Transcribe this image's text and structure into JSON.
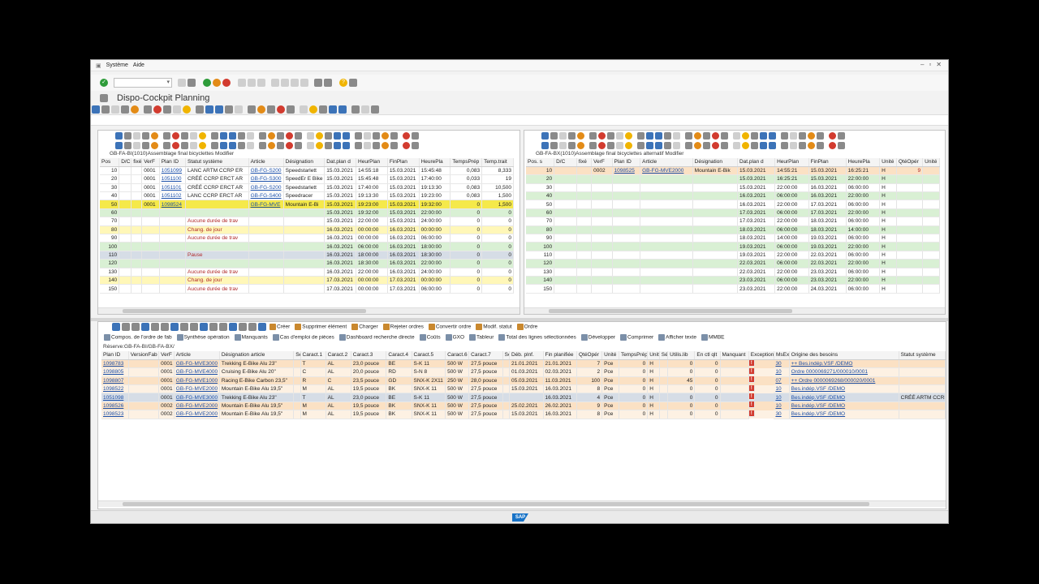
{
  "menu": {
    "systeme": "Système",
    "aide": "Aide"
  },
  "header": {
    "title": "Dispo-Cockpit Planning"
  },
  "left": {
    "caption": "GB-FA-BI(1010)Assemblage final bicyclettes Modifier",
    "columns": [
      "Pos",
      "D/C",
      "fixé",
      "VerF",
      "Plan ID",
      "Statut système",
      "Article",
      "Désignation",
      "Dat.plan d",
      "HeurPlan",
      "FinPlan",
      "HeurePla",
      "TempsPrép",
      "Temp.trait"
    ],
    "rows": [
      [
        "10",
        "",
        "",
        "0001",
        "1051099",
        "LANC ARTM CCRP ER",
        "GB-FG-S200",
        "Speedstarlett",
        "15.03.2021",
        "14:55:18",
        "15.03.2021",
        "15:45:48",
        "0,083",
        "8,333"
      ],
      [
        "20",
        "",
        "",
        "0001",
        "1051100",
        "CRÉÉ CCRP ERCT AR",
        "GB-FG-S300",
        "SpeedEr E Bike",
        "15.03.2021",
        "15:45:48",
        "15.03.2021",
        "17:40:00",
        "0,033",
        "19"
      ],
      [
        "30",
        "",
        "",
        "0001",
        "1051101",
        "CRÉÉ CCRP ERCT AR",
        "GB-FG-S200",
        "Speedstarlett",
        "15.03.2021",
        "17:40:00",
        "15.03.2021",
        "19:13:30",
        "0,083",
        "10,500"
      ],
      [
        "40",
        "",
        "",
        "0001",
        "1051102",
        "LANC CCRP ERCT AR",
        "GB-FG-S400",
        "Speedracer",
        "15.03.2021",
        "19:13:30",
        "15.03.2021",
        "19:23:00",
        "0,083",
        "1,500"
      ],
      [
        "50",
        "",
        "",
        "0001",
        "1098524",
        "",
        "GB-FG-MVE",
        "Mountain E-Bi",
        "15.03.2021",
        "19:23:00",
        "15.03.2021",
        "19:32:00",
        "0",
        "1,500"
      ],
      [
        "60",
        "",
        "",
        "",
        "",
        "",
        "",
        "",
        "15.03.2021",
        "19:32:00",
        "15.03.2021",
        "22:00:00",
        "0",
        "0"
      ],
      [
        "70",
        "",
        "",
        "",
        "",
        "Aucune durée de trav",
        "",
        "",
        "15.03.2021",
        "22:00:00",
        "15.03.2021",
        "24:00:00",
        "0",
        "0"
      ],
      [
        "80",
        "",
        "",
        "",
        "",
        "Chang. de jour",
        "",
        "",
        "16.03.2021",
        "00:00:00",
        "16.03.2021",
        "00:00:00",
        "0",
        "0"
      ],
      [
        "90",
        "",
        "",
        "",
        "",
        "Aucune durée de trav",
        "",
        "",
        "16.03.2021",
        "00:00:00",
        "16.03.2021",
        "06:00:00",
        "0",
        "0"
      ],
      [
        "100",
        "",
        "",
        "",
        "",
        "",
        "",
        "",
        "16.03.2021",
        "06:00:00",
        "16.03.2021",
        "18:00:00",
        "0",
        "0"
      ],
      [
        "110",
        "",
        "",
        "",
        "",
        "Pause",
        "",
        "",
        "16.03.2021",
        "18:00:00",
        "16.03.2021",
        "18:30:00",
        "0",
        "0"
      ],
      [
        "120",
        "",
        "",
        "",
        "",
        "",
        "",
        "",
        "16.03.2021",
        "18:30:00",
        "16.03.2021",
        "22:00:00",
        "0",
        "0"
      ],
      [
        "130",
        "",
        "",
        "",
        "",
        "Aucune durée de trav",
        "",
        "",
        "16.03.2021",
        "22:00:00",
        "16.03.2021",
        "24:00:00",
        "0",
        "0"
      ],
      [
        "140",
        "",
        "",
        "",
        "",
        "Chang. de jour",
        "",
        "",
        "17.03.2021",
        "00:00:00",
        "17.03.2021",
        "00:00:00",
        "0",
        "0"
      ],
      [
        "150",
        "",
        "",
        "",
        "",
        "Aucune durée de trav",
        "",
        "",
        "17.03.2021",
        "00:00:00",
        "17.03.2021",
        "06:00:00",
        "0",
        "0"
      ]
    ],
    "row_colors": [
      "bwhite",
      "bwhite",
      "bwhite",
      "bwhite",
      "bsel",
      "bgreen",
      "bwhite",
      "byellow",
      "bwhite",
      "bgreen",
      "bgray",
      "bgreen",
      "bwhite",
      "byellow",
      "bwhite"
    ]
  },
  "right": {
    "caption": "GB-FA-BX(1010)Assemblage final bicyclettes alternatif Modifier",
    "columns": [
      "Pos. s",
      "D/C",
      "fixé",
      "VerF",
      "Plan ID",
      "Article",
      "Désignation",
      "Dat.plan d",
      "HeurPlan",
      "FinPlan",
      "HeurePla",
      "Unité",
      "QtéOpér",
      "Unité"
    ],
    "rows": [
      [
        "10",
        "",
        "",
        "0002",
        "1098525",
        "GB-FG-MVE2000",
        "Mountain E-Bik",
        "15.03.2021",
        "14:55:21",
        "15.03.2021",
        "16:25:21",
        "H",
        "9",
        ""
      ],
      [
        "20",
        "",
        "",
        "",
        "",
        "",
        "",
        "15.03.2021",
        "16:25:21",
        "15.03.2021",
        "22:00:00",
        "H",
        "",
        ""
      ],
      [
        "30",
        "",
        "",
        "",
        "",
        "",
        "",
        "15.03.2021",
        "22:00:00",
        "16.03.2021",
        "06:00:00",
        "H",
        "",
        ""
      ],
      [
        "40",
        "",
        "",
        "",
        "",
        "",
        "",
        "16.03.2021",
        "06:00:00",
        "16.03.2021",
        "22:00:00",
        "H",
        "",
        ""
      ],
      [
        "50",
        "",
        "",
        "",
        "",
        "",
        "",
        "16.03.2021",
        "22:00:00",
        "17.03.2021",
        "06:00:00",
        "H",
        "",
        ""
      ],
      [
        "60",
        "",
        "",
        "",
        "",
        "",
        "",
        "17.03.2021",
        "06:00:00",
        "17.03.2021",
        "22:00:00",
        "H",
        "",
        ""
      ],
      [
        "70",
        "",
        "",
        "",
        "",
        "",
        "",
        "17.03.2021",
        "22:00:00",
        "18.03.2021",
        "06:00:00",
        "H",
        "",
        ""
      ],
      [
        "80",
        "",
        "",
        "",
        "",
        "",
        "",
        "18.03.2021",
        "06:00:00",
        "18.03.2021",
        "14:00:00",
        "H",
        "",
        ""
      ],
      [
        "90",
        "",
        "",
        "",
        "",
        "",
        "",
        "18.03.2021",
        "14:00:00",
        "19.03.2021",
        "06:00:00",
        "H",
        "",
        ""
      ],
      [
        "100",
        "",
        "",
        "",
        "",
        "",
        "",
        "19.03.2021",
        "06:00:00",
        "19.03.2021",
        "22:00:00",
        "H",
        "",
        ""
      ],
      [
        "110",
        "",
        "",
        "",
        "",
        "",
        "",
        "19.03.2021",
        "22:00:00",
        "22.03.2021",
        "06:00:00",
        "H",
        "",
        ""
      ],
      [
        "120",
        "",
        "",
        "",
        "",
        "",
        "",
        "22.03.2021",
        "06:00:00",
        "22.03.2021",
        "22:00:00",
        "H",
        "",
        ""
      ],
      [
        "130",
        "",
        "",
        "",
        "",
        "",
        "",
        "22.03.2021",
        "22:00:00",
        "23.03.2021",
        "06:00:00",
        "H",
        "",
        ""
      ],
      [
        "140",
        "",
        "",
        "",
        "",
        "",
        "",
        "23.03.2021",
        "06:00:00",
        "23.03.2021",
        "22:00:00",
        "H",
        "",
        ""
      ],
      [
        "150",
        "",
        "",
        "",
        "",
        "",
        "",
        "23.03.2021",
        "22:00:00",
        "24.03.2021",
        "06:00:00",
        "H",
        "",
        ""
      ]
    ],
    "row_colors": [
      "borange",
      "bgreen",
      "bwhite",
      "bgreen",
      "bwhite",
      "bgreen",
      "bwhite",
      "bgreen",
      "bwhite",
      "bgreen",
      "bwhite",
      "bgreen",
      "bwhite",
      "bgreen",
      "bwhite"
    ]
  },
  "bottom": {
    "buttons": [
      "Créer",
      "Supprimer élément",
      "Charger",
      "Rejeter ordres",
      "Convertir ordre",
      "Modif. statut",
      "Ordre"
    ],
    "buttons2": [
      "Compos. de l'ordre de fab",
      "Synthèse opération",
      "Manquants",
      "Cas d'emploi de pièces",
      "Dashboard recherche directe",
      "Coûts",
      "GXO",
      "Tableur",
      "Total des lignes sélectionnées",
      "Développer",
      "Comprimer",
      "Afficher texte",
      "MMBE"
    ],
    "reserve": "Réserve:GB-FA-BI/GB-FA-BX/",
    "columns": [
      "Plan ID",
      "VersionFab",
      "VerF",
      "Article",
      "Désignation article",
      "Sé",
      "Caract.1",
      "Caract.2",
      "Caract.3",
      "Caract.4",
      "Caract.5",
      "Caract.6",
      "Caract.7",
      "Sé",
      "Déb. plnf.",
      "Fin planifiée",
      "QtéOpér",
      "Unité",
      "TempsPrép",
      "Unité",
      "Sé",
      "Utilis.lib",
      "En ctl qlt",
      "Manquant",
      "Exceptions",
      "MsEx",
      "Origine des besoins",
      "Statut système"
    ],
    "rows": [
      [
        "1098783",
        "",
        "0001",
        "GB-FG-MVE3000",
        "Trekking E-Bike Alu 23\"",
        "",
        "T",
        "AL",
        "23,0 pouce",
        "BE",
        "S-K 11",
        "500 W",
        "27,5 pouce",
        "",
        "21.01.2021",
        "21.01.2021",
        "7",
        "Pce",
        "0",
        "H",
        "",
        "0",
        "0",
        "",
        "!",
        "30",
        "++ Bes.indép.VSF /DEMO",
        ""
      ],
      [
        "1098805",
        "",
        "0001",
        "GB-FG-MVE4000",
        "Cruising E-Bike Alu 20\"",
        "",
        "C",
        "AL",
        "20,0 pouce",
        "RD",
        "S-N 8",
        "500 W",
        "27,5 pouce",
        "",
        "01.03.2021",
        "02.03.2021",
        "2",
        "Pce",
        "0",
        "H",
        "",
        "0",
        "0",
        "",
        "!",
        "10",
        "Ordre      0000069271/000010/0001",
        ""
      ],
      [
        "1098807",
        "",
        "0001",
        "GB-FG-MVE1000",
        "Racing E-Bike Carbon 23,5\"",
        "",
        "R",
        "C",
        "23,5 pouce",
        "GD",
        "SNX-K 2X11",
        "250 W",
        "28,0 pouce",
        "",
        "05.03.2021",
        "11.03.2021",
        "100",
        "Pce",
        "0",
        "H",
        "",
        "45",
        "0",
        "",
        "!",
        "07",
        "++ Ordre      0000069268/000020/0001",
        ""
      ],
      [
        "1098522",
        "",
        "0001",
        "GB-FG-MVE2000",
        "Mountain E-Bike Alu 19,5\"",
        "",
        "M",
        "AL",
        "19,5 pouce",
        "BK",
        "SNX-K 11",
        "500 W",
        "27,5 pouce",
        "",
        "15.03.2021",
        "16.03.2021",
        "8",
        "Pce",
        "0",
        "H",
        "",
        "0",
        "0",
        "",
        "!",
        "10",
        "Bes.indép.VSF /DEMO",
        ""
      ],
      [
        "1051098",
        "",
        "0001",
        "GB-FG-MVE3000",
        "Trekking E-Bike Alu 23\"",
        "",
        "T",
        "AL",
        "23,0 pouce",
        "BE",
        "S-K 11",
        "500 W",
        "27,5 pouce",
        "",
        "",
        "16.03.2021",
        "4",
        "Pce",
        "0",
        "H",
        "",
        "0",
        "0",
        "",
        "!",
        "10",
        "Bes.indép.VSF /DEMO",
        "CRÉÉ ARTM CCRP E"
      ],
      [
        "1098526",
        "",
        "0002",
        "GB-FG-MVE2000",
        "Mountain E-Bike Alu 19,5\"",
        "",
        "M",
        "AL",
        "19,5 pouce",
        "BK",
        "SNX-K 11",
        "500 W",
        "27,5 pouce",
        "",
        "25.02.2021",
        "26.02.2021",
        "9",
        "Pce",
        "0",
        "H",
        "",
        "0",
        "0",
        "",
        "!",
        "10",
        "Bes.indép.VSF /DEMO",
        ""
      ],
      [
        "1098523",
        "",
        "0002",
        "GB-FG-MVE2000",
        "Mountain E-Bike Alu 19,5\"",
        "",
        "M",
        "AL",
        "19,5 pouce",
        "BK",
        "SNX-K 11",
        "500 W",
        "27,5 pouce",
        "",
        "15.03.2021",
        "16.03.2021",
        "8",
        "Pce",
        "0",
        "H",
        "",
        "0",
        "0",
        "",
        "!",
        "30",
        "Bes.indép.VSF /DEMO",
        ""
      ]
    ],
    "row_colors": [
      "borange",
      "bpale",
      "borange",
      "bpale",
      "bgray",
      "borange",
      "bpale"
    ]
  },
  "status": {
    "logo": "SAP"
  },
  "colors": {
    "accent": "#1873c7",
    "selected": "#f5e94a",
    "green": "#d9f0d4"
  }
}
